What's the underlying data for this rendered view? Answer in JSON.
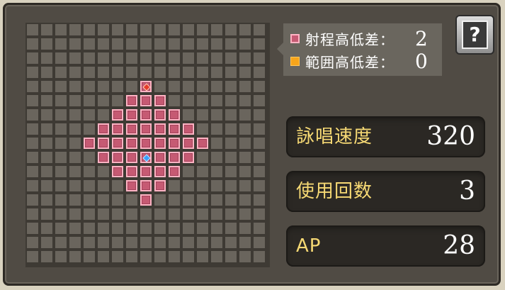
{
  "legend": {
    "items": [
      {
        "label": "射程高低差：",
        "value": "2",
        "color": "#c65a73"
      },
      {
        "label": "範囲高低差：",
        "value": "0",
        "color": "#f7a51a"
      }
    ]
  },
  "help": {
    "icon": "question-book-icon",
    "symbol": "?"
  },
  "stats": [
    {
      "label": "詠唱速度",
      "value": "320"
    },
    {
      "label": "使用回数",
      "value": "3"
    },
    {
      "label": "AP",
      "value": "28"
    }
  ],
  "range_grid": {
    "size": 17,
    "origin": [
      8,
      9
    ],
    "target": [
      8,
      4
    ],
    "rows": [
      "00000000000000000",
      "00000000000000000",
      "00000000000000000",
      "00000000000000000",
      "00000000100000000",
      "00000001110000000",
      "00000011111000000",
      "00000111111100000",
      "00001111111110000",
      "00000111111100000",
      "00000011111000000",
      "00000001110000000",
      "00000000100000000",
      "00000000000000000",
      "00000000000000000",
      "00000000000000000",
      "00000000000000000"
    ]
  }
}
